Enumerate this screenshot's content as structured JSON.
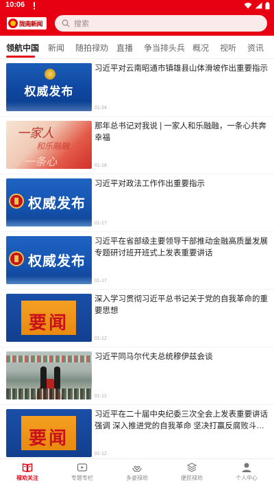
{
  "status_bar": {
    "time": "10:06",
    "time_alert_icon": "alert-icon",
    "icons": [
      "wifi-icon",
      "signal-icon",
      "battery-icon"
    ]
  },
  "header": {
    "logo_text": "陇南新闻",
    "search_placeholder": "搜索",
    "accent_color": "#e60012"
  },
  "tabs": [
    {
      "label": "领航中国",
      "active": true
    },
    {
      "label": "新闻",
      "active": false
    },
    {
      "label": "随拍禄劝",
      "active": false
    },
    {
      "label": "直播",
      "active": false
    },
    {
      "label": "争当排头兵",
      "active": false
    },
    {
      "label": "概况",
      "active": false
    },
    {
      "label": "视听",
      "active": false
    },
    {
      "label": "资讯",
      "active": false
    }
  ],
  "news": [
    {
      "title": "习近平对云南昭通市镇雄县山体滑坡作出重要指示",
      "date": "01-24",
      "thumb_text": "权威发布"
    },
    {
      "title": "那年总书记对我说 | 一家人和乐融融，一条心共奔幸福",
      "date": "01-18",
      "thumb_text": "一家人"
    },
    {
      "title": "习近平对政法工作作出重要指示",
      "date": "01-17",
      "thumb_text": "权威发布"
    },
    {
      "title": "习近平在省部级主要领导干部推动金融高质量发展专题研讨班开班式上发表重要讲话",
      "date": "01-17",
      "thumb_text": "权威发布"
    },
    {
      "title": "深入学习贯彻习近平总书记关于党的自我革命的重要思想",
      "date": "01-12",
      "thumb_text": "要闻"
    },
    {
      "title": "习近平同马尔代夫总统穆伊兹会谈",
      "date": "01-12",
      "thumb_text": ""
    },
    {
      "title": "习近平在二十届中央纪委三次全会上发表重要讲话强调 深入推进党的自我革命 坚决打赢反腐败斗争攻坚战…",
      "date": "01-12",
      "thumb_text": "要闻"
    }
  ],
  "bottom_nav": [
    {
      "label": "禄劝关注",
      "icon": "book-icon",
      "active": true
    },
    {
      "label": "专题专栏",
      "icon": "video-icon",
      "active": false
    },
    {
      "label": "多姿禄劝",
      "icon": "hands-heart-icon",
      "active": false
    },
    {
      "label": "便民禄劝",
      "icon": "layers-icon",
      "active": false
    },
    {
      "label": "个人中心",
      "icon": "user-icon",
      "active": false
    }
  ]
}
